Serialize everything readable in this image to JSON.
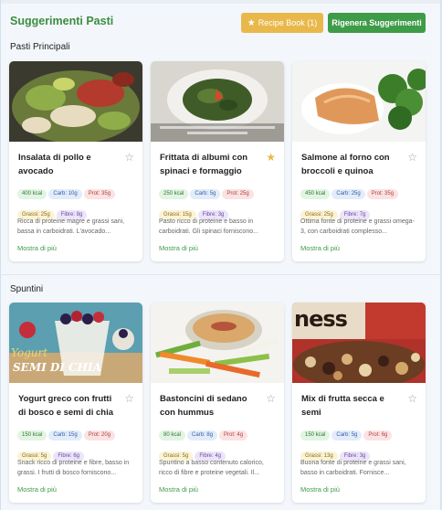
{
  "header": {
    "title": "Suggerimenti Pasti",
    "recipe_book_label": "Recipe Book (1)",
    "regenerate_label": "Rigenera Suggerimenti"
  },
  "colors": {
    "accent_green": "#3e9b48",
    "recipe_book": "#e9b84a"
  },
  "sections": [
    {
      "title": "Pasti Principali",
      "cards": [
        {
          "title": "Insalata di pollo e avocado",
          "favorite": false,
          "kcal": "400 kcal",
          "carb": "Carb: 10g",
          "prot": "Prot: 35g",
          "fat": "Grassi: 25g",
          "fiber": "Fibre: 8g",
          "description": "Ricca di proteine magre e grassi sani, bassa in carboidrati. L'avocado...",
          "more": "Mostra di più"
        },
        {
          "title": "Frittata di albumi con spinaci e formaggio",
          "favorite": true,
          "kcal": "250 kcal",
          "carb": "Carb: 5g",
          "prot": "Prot: 25g",
          "fat": "Grassi: 15g",
          "fiber": "Fibre: 3g",
          "description": "Pasto ricco di proteine e basso in carboidrati. Gli spinaci forniscono...",
          "more": "Mostra di più"
        },
        {
          "title": "Salmone al forno con broccoli e quinoa",
          "favorite": false,
          "kcal": "450 kcal",
          "carb": "Carb: 25g",
          "prot": "Prot: 35g",
          "fat": "Grassi: 25g",
          "fiber": "Fibre: 7g",
          "description": "Ottima fonte di proteine e grassi omega-3, con carboidrati complesso...",
          "more": "Mostra di più"
        }
      ]
    },
    {
      "title": "Spuntini",
      "cards": [
        {
          "title": "Yogurt greco con frutti di bosco e semi di chia",
          "favorite": false,
          "overlay_small": "Yogurt",
          "overlay_big": "SEMI DI CHIA",
          "kcal": "150 kcal",
          "carb": "Carb: 15g",
          "prot": "Prot: 20g",
          "fat": "Grassi: 5g",
          "fiber": "Fibre: 6g",
          "description": "Snack ricco di proteine e fibre, basso in grassi. I frutti di bosco forniscono...",
          "more": "Mostra di più"
        },
        {
          "title": "Bastoncini di sedano con hummus",
          "favorite": false,
          "kcal": "80 kcal",
          "carb": "Carb: 8g",
          "prot": "Prot: 4g",
          "fat": "Grassi: 5g",
          "fiber": "Fibre: 4g",
          "description": "Spuntino a basso contenuto calorico, ricco di fibre e proteine vegetali. Il...",
          "more": "Mostra di più"
        },
        {
          "title": "Mix di frutta secca e semi",
          "favorite": false,
          "overlay_big": "ness",
          "kcal": "150 kcal",
          "carb": "Carb: 5g",
          "prot": "Prot: 6g",
          "fat": "Grassi: 13g",
          "fiber": "Fibre: 3g",
          "description": "Buona fonte di proteine e grassi sani, basso in carboidrati. Fornisce...",
          "more": "Mostra di più"
        }
      ]
    }
  ]
}
